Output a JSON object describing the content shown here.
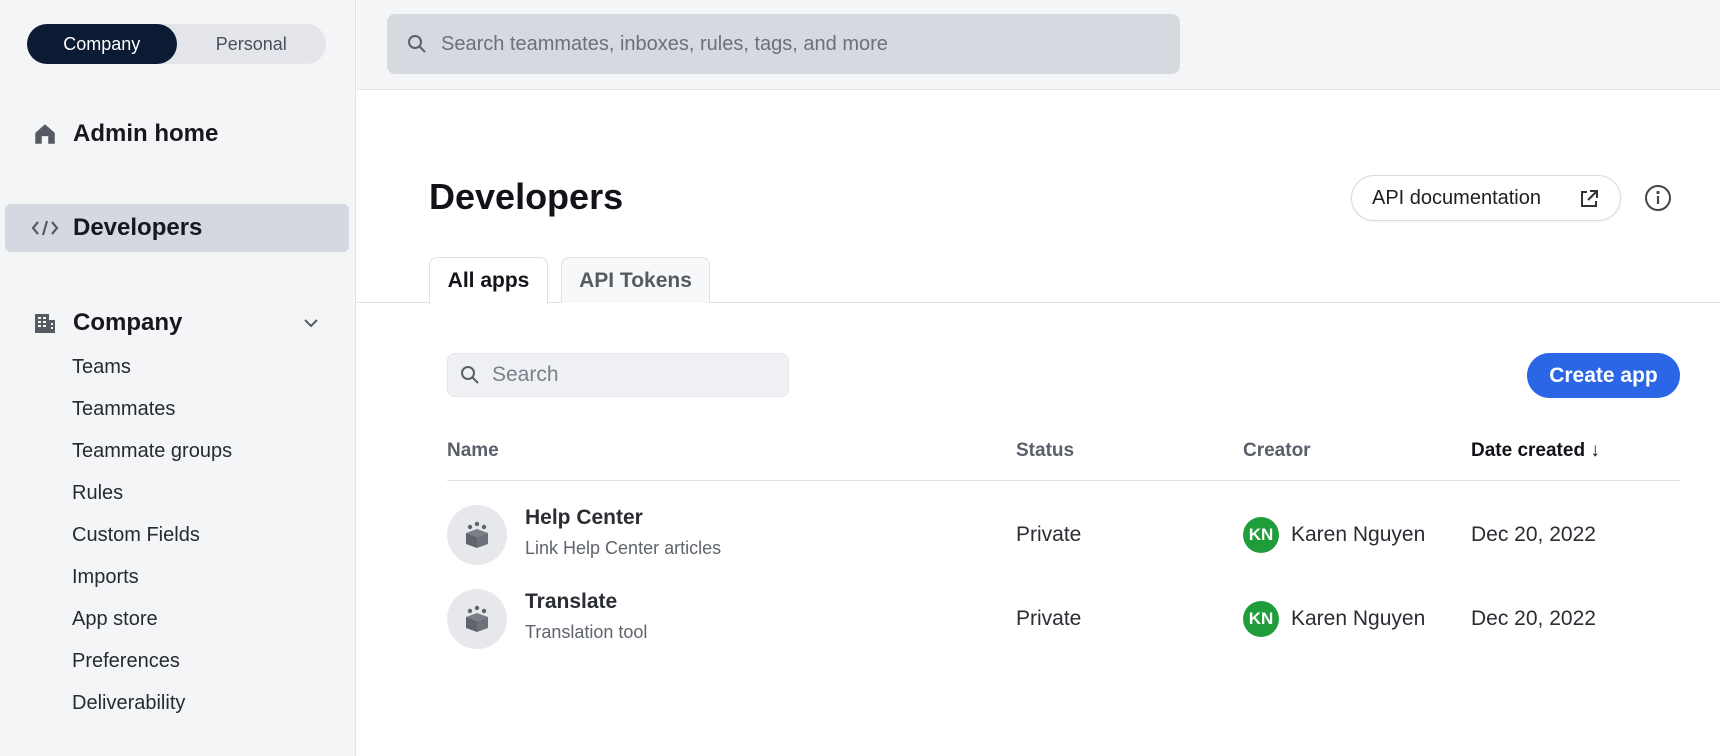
{
  "scope_toggle": {
    "company": "Company",
    "personal": "Personal"
  },
  "sidebar": {
    "admin_home": "Admin home",
    "developers": "Developers",
    "company": "Company",
    "company_items": [
      "Teams",
      "Teammates",
      "Teammate groups",
      "Rules",
      "Custom Fields",
      "Imports",
      "App store",
      "Preferences",
      "Deliverability"
    ]
  },
  "global_search": {
    "placeholder": "Search teammates, inboxes, rules, tags, and more"
  },
  "page": {
    "title": "Developers",
    "api_doc_label": "API documentation"
  },
  "tabs": [
    "All apps",
    "API Tokens"
  ],
  "app_search": {
    "placeholder": "Search"
  },
  "create_app_label": "Create app",
  "table": {
    "columns": [
      "Name",
      "Status",
      "Creator",
      "Date created ↓"
    ],
    "rows": [
      {
        "name": "Help Center",
        "description": "Link Help Center articles",
        "status": "Private",
        "creator_initials": "KN",
        "creator": "Karen Nguyen",
        "date": "Dec 20, 2022"
      },
      {
        "name": "Translate",
        "description": "Translation tool",
        "status": "Private",
        "creator_initials": "KN",
        "creator": "Karen Nguyen",
        "date": "Dec 20, 2022"
      }
    ]
  },
  "colors": {
    "accent": "#2b66e6",
    "nav_dark": "#0b1b33",
    "avatar_green": "#1f9d3a"
  }
}
